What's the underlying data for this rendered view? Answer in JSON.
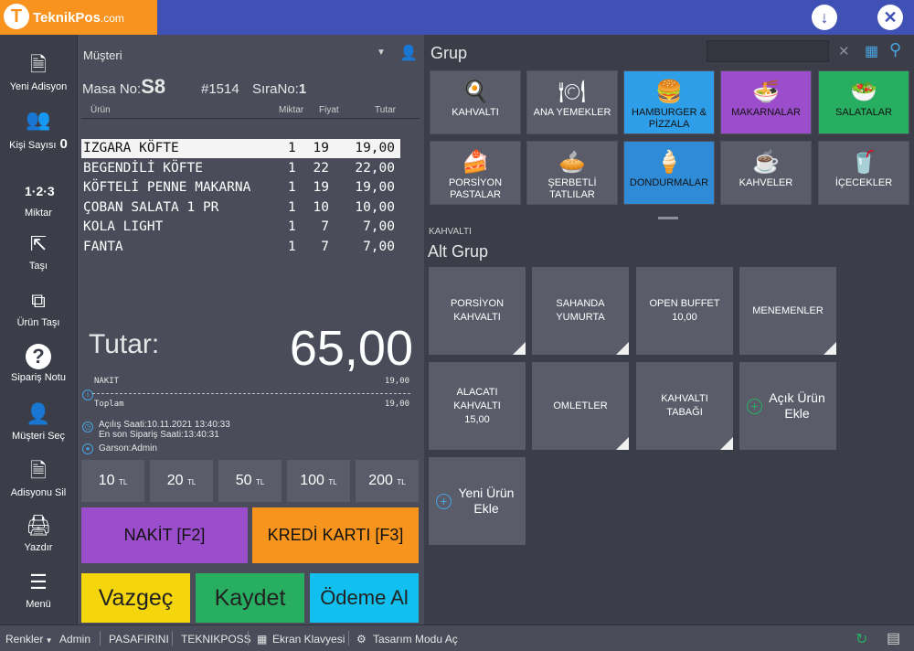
{
  "app": {
    "logo_main": "TeknikPos",
    "logo_domain": ".com"
  },
  "topbar": {
    "download_icon": "download-icon",
    "close_icon": "close-icon"
  },
  "sidenav": [
    {
      "label": "Yeni Adisyon",
      "icon": "new-document-icon",
      "glyph": "🗎"
    },
    {
      "label": "Kişi Sayısı",
      "icon": "people-icon",
      "glyph": "👥",
      "count": "0"
    },
    {
      "label": "Miktar",
      "icon": "quantity-icon",
      "glyph": "1·2·3"
    },
    {
      "label": "Taşı",
      "icon": "move-icon",
      "glyph": "⇱"
    },
    {
      "label": "Ürün Taşı",
      "icon": "move-product-icon",
      "glyph": "⧉"
    },
    {
      "label": "Sipariş Notu",
      "icon": "order-note-icon",
      "glyph": "?"
    },
    {
      "label": "Müşteri Seç",
      "icon": "customer-select-icon",
      "glyph": "👤"
    },
    {
      "label": "Adisyonu Sil",
      "icon": "delete-document-icon",
      "glyph": "🗎"
    },
    {
      "label": "Yazdır",
      "icon": "printer-icon",
      "glyph": "🖨"
    },
    {
      "label": "Menü",
      "icon": "menu-icon",
      "glyph": "☰"
    }
  ],
  "ticket": {
    "customer_label": "Müşteri",
    "masa_prefix": "Masa No:",
    "masa_no": "S8",
    "order_no": "#1514",
    "sira_prefix": "SıraNo:",
    "sira_no": "1",
    "columns": {
      "product": "Ürün",
      "qty": "Miktar",
      "price": "Fiyat",
      "total": "Tutar"
    },
    "items": [
      {
        "name": "IZGARA KÖFTE",
        "qty": "1",
        "price": "19",
        "total": "19,00",
        "selected": true
      },
      {
        "name": "BEGENDİLİ KÖFTE",
        "qty": "1",
        "price": "22",
        "total": "22,00"
      },
      {
        "name": "KÖFTELİ PENNE MAKARNA",
        "qty": "1",
        "price": "19",
        "total": "19,00"
      },
      {
        "name": "ÇOBAN SALATA 1 PR",
        "qty": "1",
        "price": "10",
        "total": "10,00"
      },
      {
        "name": "KOLA LIGHT",
        "qty": "1",
        "price": "7",
        "total": "7,00"
      },
      {
        "name": "FANTA",
        "qty": "1",
        "price": "7",
        "total": "7,00"
      }
    ],
    "tutar_label": "Tutar:",
    "tutar_value": "65,00",
    "nakit_label": "NAKIT",
    "nakit_value": "19,00",
    "toplam_label": "Toplam",
    "toplam_value": "19,00",
    "opened_at": "Açılış Saati:10.11.2021 13:40:33",
    "last_order_at": "En son Sipariş Saati:13:40:31",
    "waiter": "Garson:Admin",
    "money_buttons": [
      "10",
      "20",
      "50",
      "100",
      "200"
    ],
    "currency": "TL",
    "nakit_button": "NAKİT [F2]",
    "kredi_button": "KREDİ KARTI [F3]",
    "vazgec_button": "Vazgeç",
    "kaydet_button": "Kaydet",
    "odeme_button": "Ödeme Al"
  },
  "groups": {
    "title": "Grup",
    "search_placeholder": "",
    "items": [
      {
        "label": "KAHVALTI",
        "icon": "breakfast-icon",
        "glyph": "🍳",
        "color": "#5a5d69"
      },
      {
        "label": "ANA YEMEKLER",
        "icon": "plate-icon",
        "glyph": "🍽",
        "color": "#5a5d69"
      },
      {
        "label": "HAMBURGER & PİZZALA",
        "icon": "burger-icon",
        "glyph": "🍔",
        "color": "#2f9ee8",
        "dark": true
      },
      {
        "label": "MAKARNALAR",
        "icon": "pasta-icon",
        "glyph": "🍜",
        "color": "#9c4dcc",
        "dark": true
      },
      {
        "label": "SALATALAR",
        "icon": "salad-icon",
        "glyph": "🥗",
        "color": "#27ae60",
        "dark": true
      },
      {
        "label": "PORSİYON PASTALAR",
        "icon": "cake-icon",
        "glyph": "🍰",
        "color": "#5a5d69"
      },
      {
        "label": "ŞERBETLİ TATLILAR",
        "icon": "dessert-icon",
        "glyph": "🥧",
        "color": "#5a5d69"
      },
      {
        "label": "DONDURMALAR",
        "icon": "icecream-icon",
        "glyph": "🍦",
        "color": "#2f8bd6",
        "dark": true
      },
      {
        "label": "KAHVELER",
        "icon": "coffee-icon",
        "glyph": "☕",
        "color": "#5a5d69"
      },
      {
        "label": "İÇECEKLER",
        "icon": "drink-icon",
        "glyph": "🥤",
        "color": "#5a5d69"
      }
    ]
  },
  "subgroup": {
    "section_label": "KAHVALTI",
    "title": "Alt Grup",
    "items": [
      {
        "line1": "PORSİYON",
        "line2": "KAHVALTI",
        "line3": "",
        "corner": true
      },
      {
        "line1": "SAHANDA",
        "line2": "YUMURTA",
        "line3": "",
        "corner": true
      },
      {
        "line1": "OPEN BUFFET",
        "line2": "10,00",
        "line3": "",
        "corner": false
      },
      {
        "line1": "MENEMENLER",
        "line2": "",
        "line3": "",
        "corner": true
      },
      {
        "line1": "ALACATI",
        "line2": "KAHVALTI",
        "line3": "15,00",
        "corner": false
      },
      {
        "line1": "OMLETLER",
        "line2": "",
        "line3": "",
        "corner": true
      },
      {
        "line1": "KAHVALTI",
        "line2": "TABAĞI",
        "line3": "",
        "corner": true
      },
      {
        "line1": "Açık Ürün",
        "line2": "Ekle",
        "line3": "",
        "corner": false,
        "big": true,
        "plus": "green"
      },
      {
        "line1": "Yeni Ürün",
        "line2": "Ekle",
        "line3": "",
        "corner": false,
        "big": true,
        "plus": "blue"
      }
    ]
  },
  "statusbar": {
    "colors": "Renkler",
    "user": "Admin",
    "branch": "PASAFIRINI",
    "company": "TEKNIKPOSS",
    "keyboard": "Ekran Klavyesi",
    "design_mode": "Tasarım Modu Aç"
  }
}
